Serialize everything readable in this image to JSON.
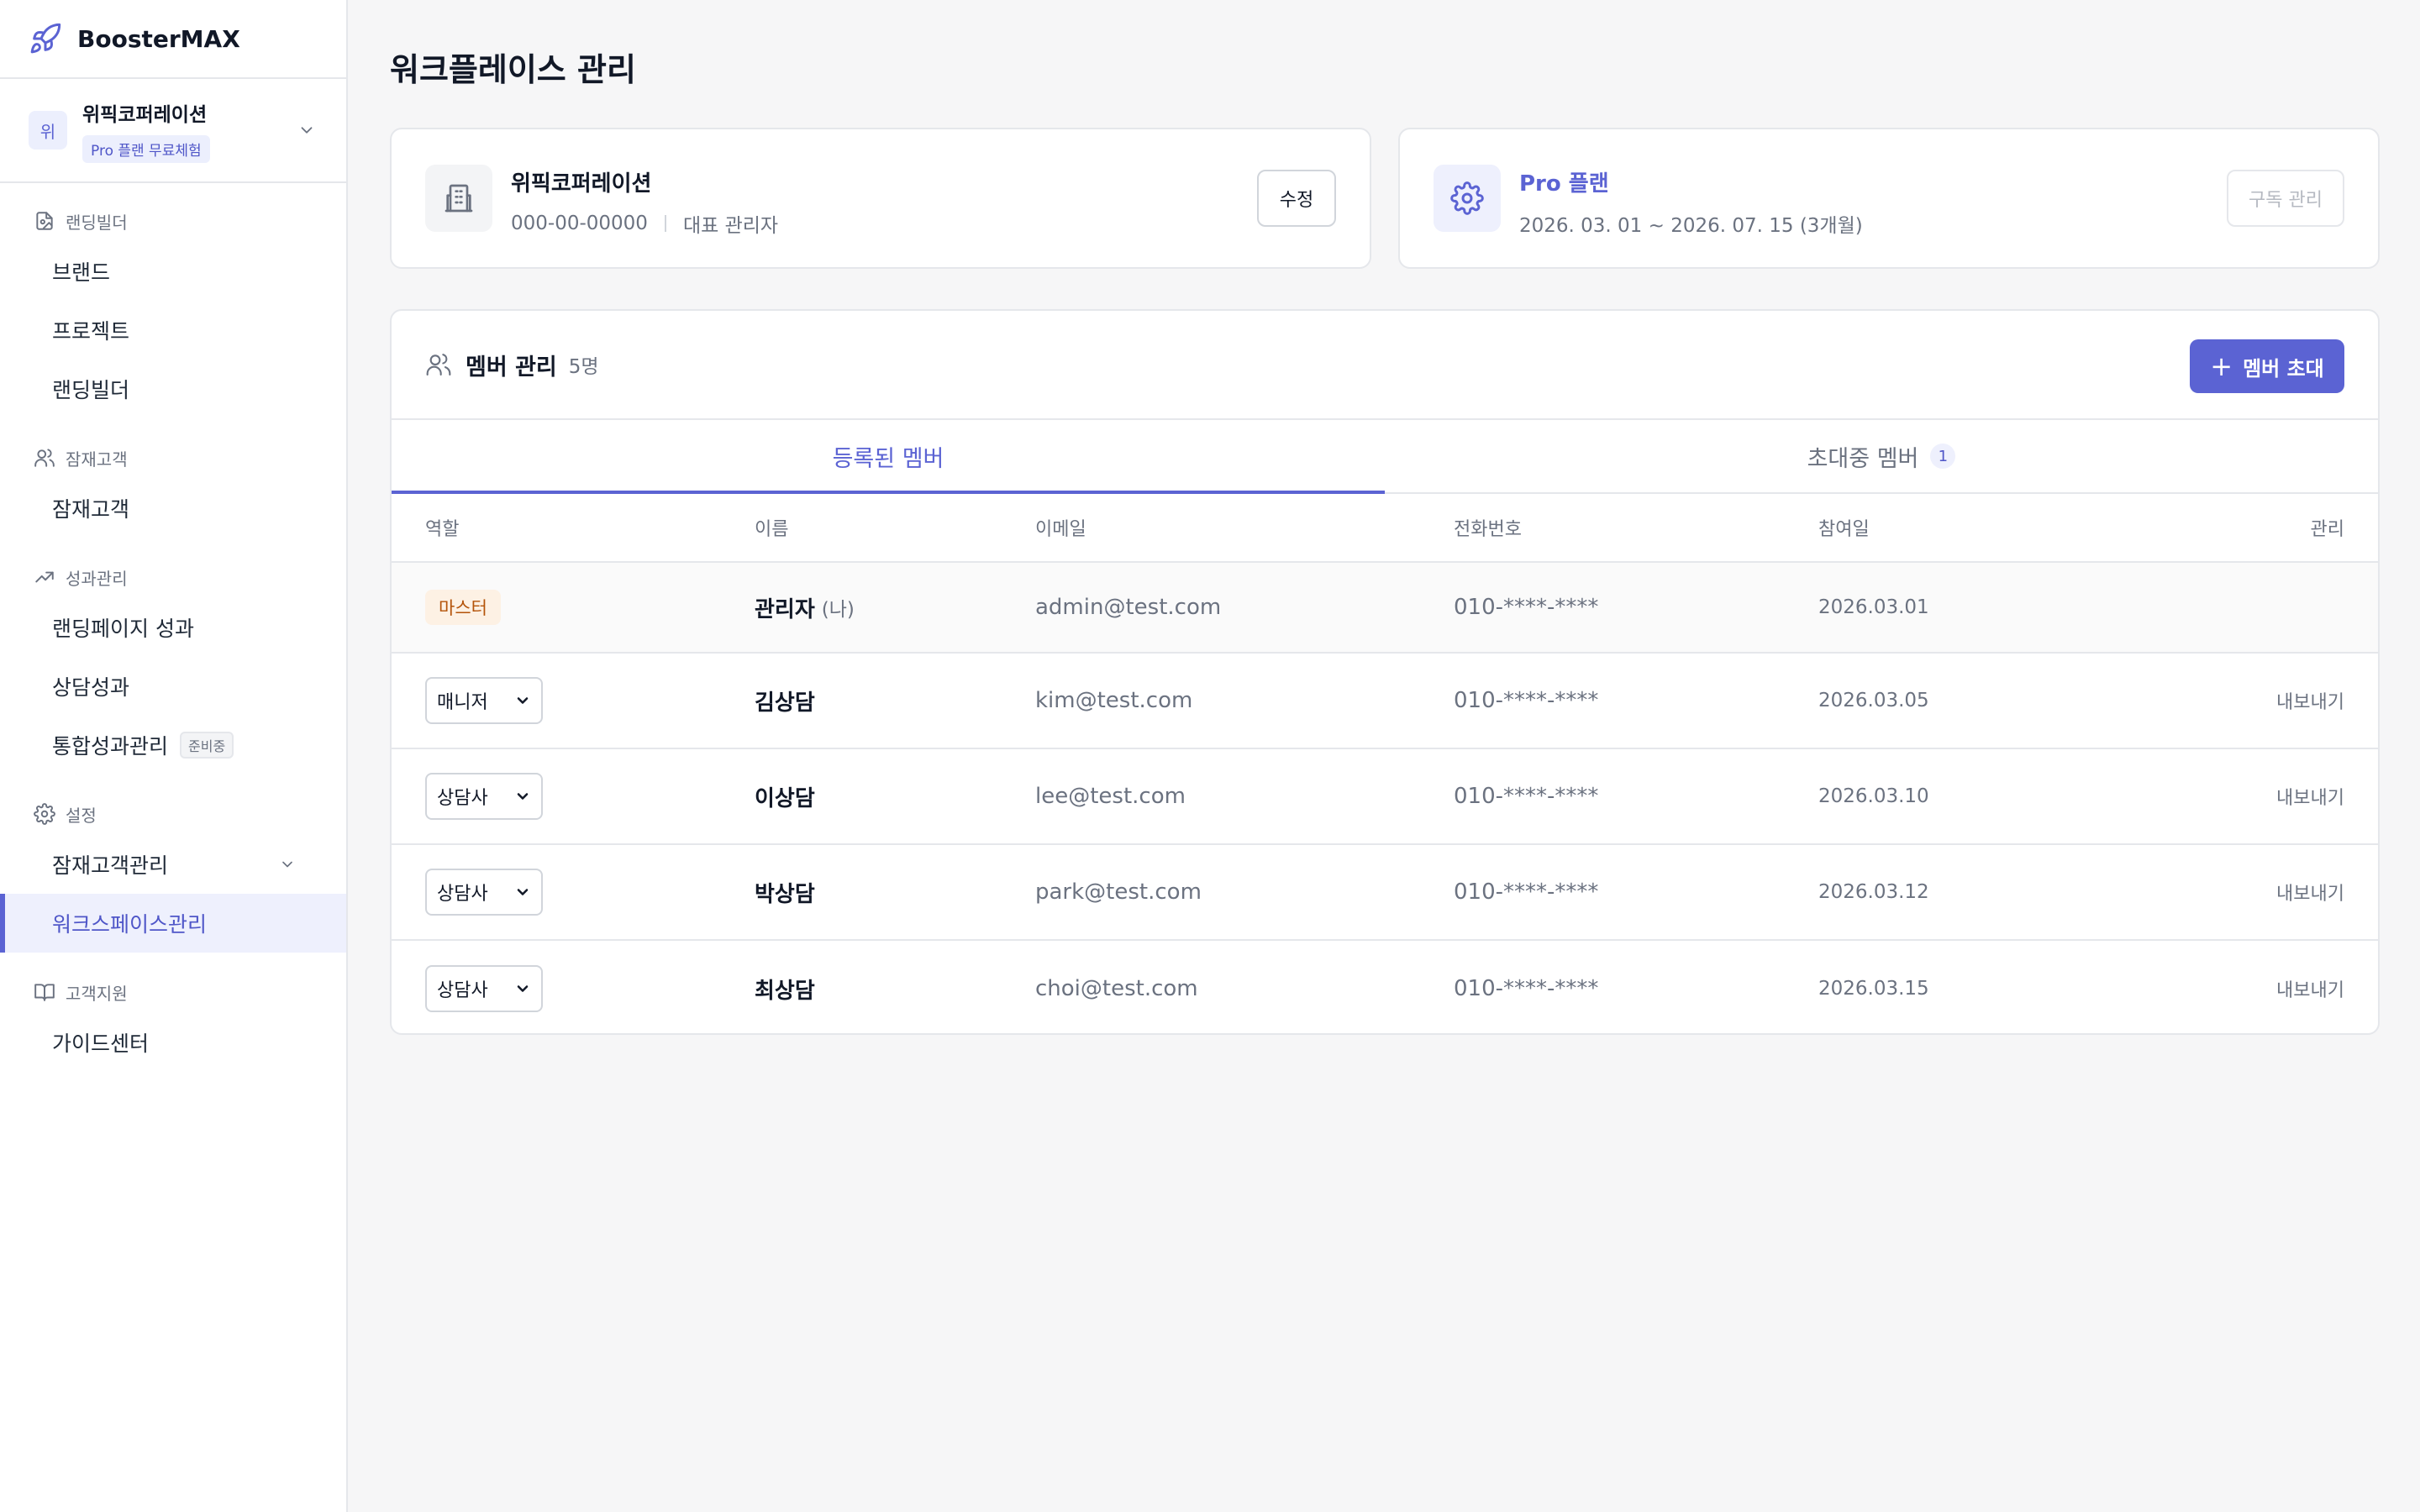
{
  "sidebar": {
    "brand": "BoosterMAX",
    "workspace": {
      "avatar": "위",
      "name": "위픽코퍼레이션",
      "badge": "Pro 플랜 무료체험"
    },
    "groups": [
      {
        "title": "랜딩빌더",
        "icon": "landing-builder-icon",
        "items": [
          "브랜드",
          "프로젝트",
          "랜딩빌더"
        ]
      },
      {
        "title": "잠재고객",
        "icon": "users-icon",
        "items": [
          "잠재고객"
        ]
      },
      {
        "title": "성과관리",
        "icon": "trend-up-icon",
        "items": [
          "랜딩페이지 성과",
          "상담성과",
          "통합성과관리"
        ],
        "soon_badge": "준비중"
      },
      {
        "title": "설정",
        "icon": "gear-icon",
        "items": [
          "잠재고객관리",
          "워크스페이스관리"
        ]
      },
      {
        "title": "고객지원",
        "icon": "book-icon",
        "items": [
          "가이드센터"
        ]
      }
    ]
  },
  "page": {
    "title": "워크플레이스 관리"
  },
  "workspace_card": {
    "name": "위픽코퍼레이션",
    "biz_number": "000-00-00000",
    "role": "대표 관리자",
    "edit_label": "수정"
  },
  "plan_card": {
    "name": "Pro 플랜",
    "period": "2026. 03. 01 ~ 2026. 07. 15 (3개월)",
    "manage_label": "구독 관리"
  },
  "members": {
    "title": "멤버 관리",
    "count": "5명",
    "invite_label": "멤버 초대",
    "tabs": [
      {
        "label": "등록된 멤버",
        "active": true
      },
      {
        "label": "초대중 멤버",
        "badge": "1"
      }
    ],
    "columns": [
      "역할",
      "이름",
      "이메일",
      "전화번호",
      "참여일",
      "관리"
    ],
    "me_label": "(나)",
    "rows": [
      {
        "role": "마스터",
        "name": "관리자",
        "email": "admin@test.com",
        "phone": "010-****-****",
        "date": "2026.03.01",
        "action": ""
      },
      {
        "role": "매니저",
        "name": "김상담",
        "email": "kim@test.com",
        "phone": "010-****-****",
        "date": "2026.03.05",
        "action": "내보내기"
      },
      {
        "role": "상담사",
        "name": "이상담",
        "email": "lee@test.com",
        "phone": "010-****-****",
        "date": "2026.03.10",
        "action": "내보내기"
      },
      {
        "role": "상담사",
        "name": "박상담",
        "email": "park@test.com",
        "phone": "010-****-****",
        "date": "2026.03.12",
        "action": "내보내기"
      },
      {
        "role": "상담사",
        "name": "최상담",
        "email": "choi@test.com",
        "phone": "010-****-****",
        "date": "2026.03.15",
        "action": "내보내기"
      }
    ]
  },
  "colors": {
    "accent": "#5b63d3",
    "master_bg": "#fdf1e4",
    "master_text": "#b45309"
  }
}
